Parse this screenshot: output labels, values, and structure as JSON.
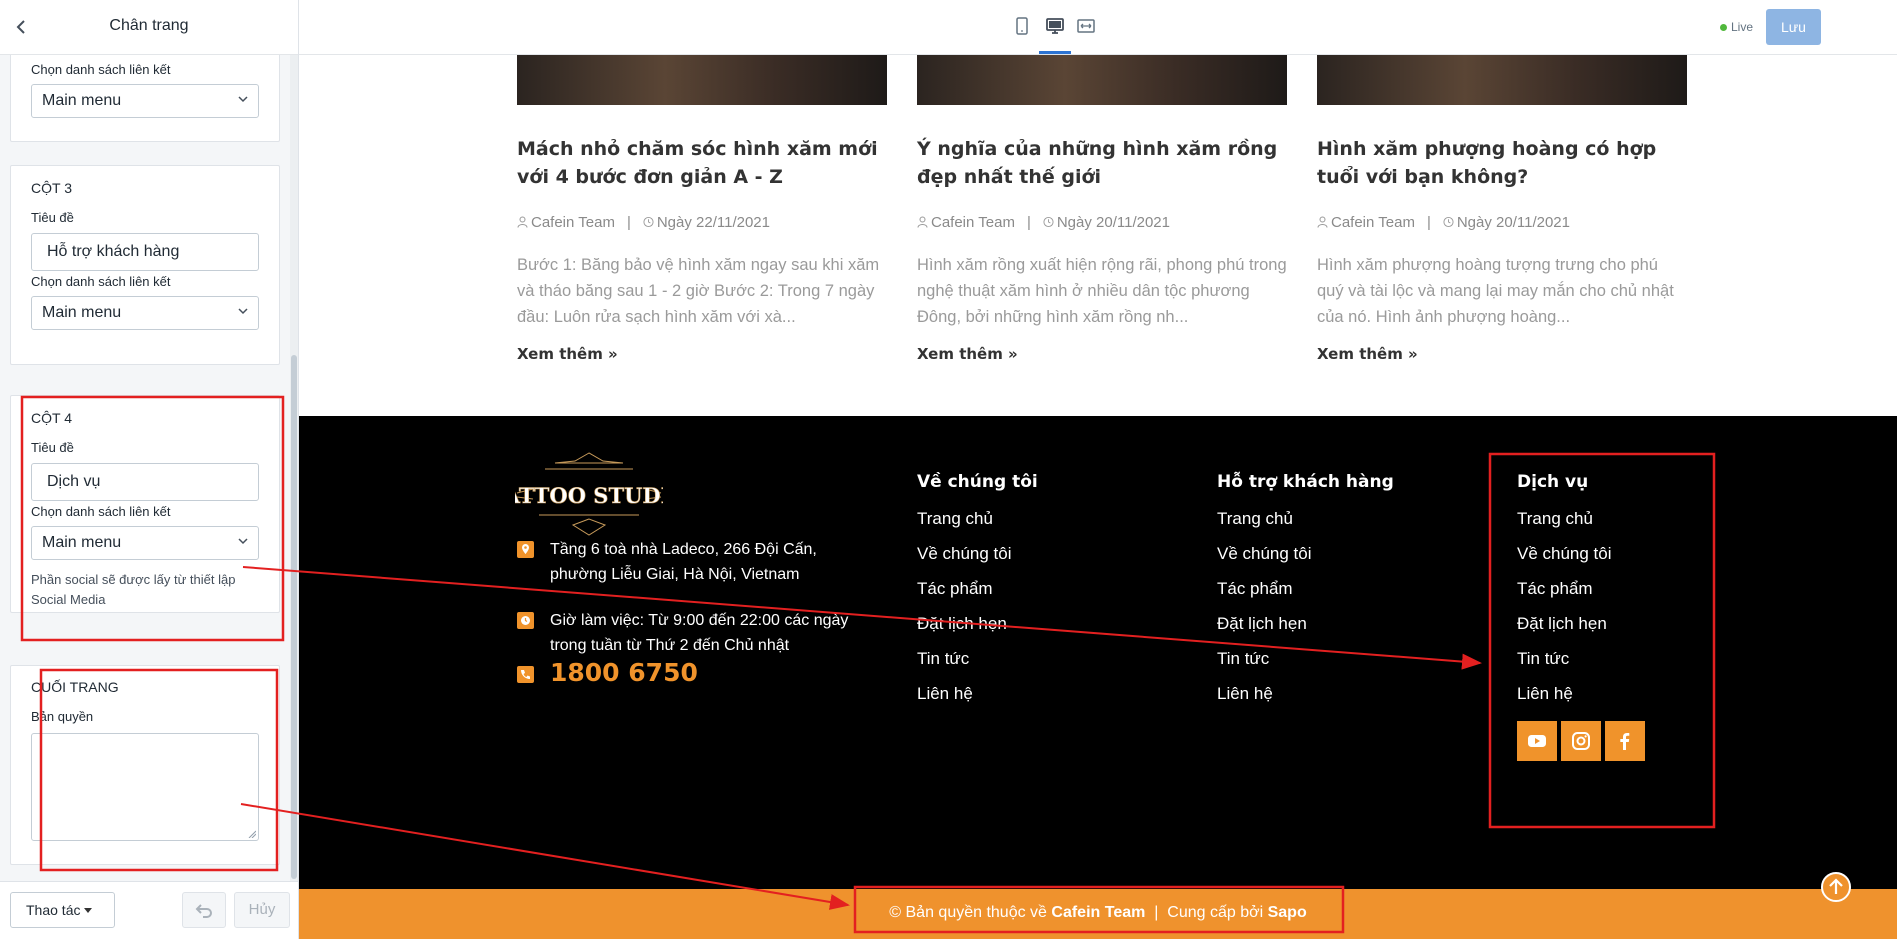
{
  "panel": {
    "title": "Chân trang",
    "col2_tail": {
      "link_list_label": "Chọn danh sách liên kết",
      "link_list_value": "Main menu"
    },
    "col3": {
      "title": "Cột 3",
      "heading_label": "Tiêu đề",
      "heading_value": "Hỗ trợ khách hàng",
      "link_list_label": "Chọn danh sách liên kết",
      "link_list_value": "Main menu"
    },
    "col4": {
      "title": "Cột 4",
      "heading_label": "Tiêu đề",
      "heading_value": "Dịch vụ",
      "link_list_label": "Chọn danh sách liên kết",
      "link_list_value": "Main menu",
      "hint": "Phần social sẽ được lấy từ thiết lập Social Media"
    },
    "bottom": {
      "title": "Cuối trang",
      "copyright_label": "Bản quyền",
      "copyright_value": ""
    },
    "footer": {
      "actions_label": "Thao tác",
      "cancel_label": "Hủy"
    }
  },
  "topbar": {
    "live_label": "Live",
    "save_label": "Lưu",
    "colors": {
      "live": "#50b83c",
      "save": "#8eb5e3",
      "active_tab": "#2c73d2"
    }
  },
  "posts": [
    {
      "title": "Mách nhỏ chăm sóc hình xăm mới với 4 bước đơn giản A - Z",
      "author": "Cafein Team",
      "date": "Ngày 22/11/2021",
      "excerpt": "Bước 1: Băng bảo vệ hình xăm ngay sau khi xăm và tháo băng sau 1 - 2 giờ Bước 2: Trong 7 ngày đầu: Luôn rửa sạch hình xăm với xà...",
      "more": "Xem thêm »"
    },
    {
      "title": "Ý nghĩa của những hình xăm rồng đẹp nhất thế giới",
      "author": "Cafein Team",
      "date": "Ngày 20/11/2021",
      "excerpt": "Hình xăm rồng xuất hiện rộng rãi, phong phú trong nghệ thuật xăm hình ở nhiều dân tộc phương Đông, bởi những hình xăm rồng nh...",
      "more": "Xem thêm »"
    },
    {
      "title": "Hình xăm phượng hoàng có hợp tuổi với bạn không?",
      "author": "Cafein Team",
      "date": "Ngày 20/11/2021",
      "excerpt": "Hình xăm phượng hoàng tượng trưng cho phú quý và tài lộc và mang lại may mắn cho chủ nhật của nó. Hình ảnh phượng hoàng...",
      "more": "Xem thêm »"
    }
  ],
  "site_footer": {
    "logo_text": "TATTOO STUDIO",
    "address": "Tầng 6 toà nhà Ladeco, 266 Đội Cấn, phường Liễu Giai, Hà Nội, Vietnam",
    "hours": "Giờ làm việc: Từ 9:00 đến 22:00 các ngày trong tuần từ Thứ 2 đến Chủ nhật",
    "hotline": "1800 6750",
    "columns": [
      {
        "title": "Về chúng tôi",
        "links": [
          "Trang chủ",
          "Về chúng tôi",
          "Tác phẩm",
          "Đặt lịch hẹn",
          "Tin tức",
          "Liên hệ"
        ]
      },
      {
        "title": "Hỗ trợ khách hàng",
        "links": [
          "Trang chủ",
          "Về chúng tôi",
          "Tác phẩm",
          "Đặt lịch hẹn",
          "Tin tức",
          "Liên hệ"
        ]
      },
      {
        "title": "Dịch vụ",
        "links": [
          "Trang chủ",
          "Về chúng tôi",
          "Tác phẩm",
          "Đặt lịch hẹn",
          "Tin tức",
          "Liên hệ"
        ]
      }
    ],
    "social": [
      "youtube-icon",
      "instagram-icon",
      "facebook-icon"
    ],
    "copyright_prefix": "© Bản quyền thuộc về ",
    "copyright_brand": "Cafein Team",
    "copyright_sep": "  |  Cung cấp bởi ",
    "copyright_provider": "Sapo",
    "colors": {
      "accent": "#ef922d",
      "footer_bg": "#000000",
      "annotation": "#e32020"
    }
  }
}
